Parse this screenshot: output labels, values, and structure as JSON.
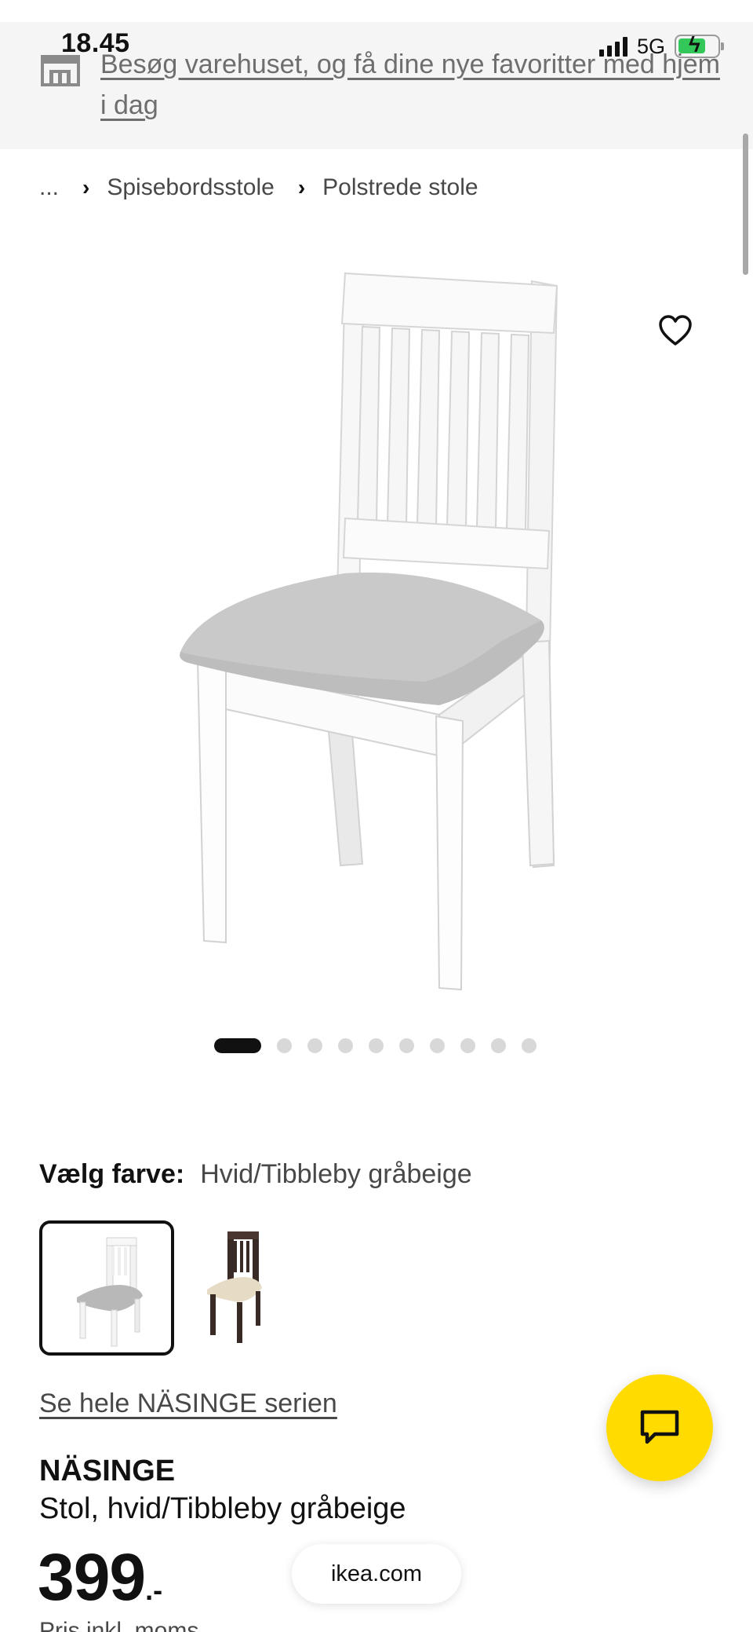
{
  "status_bar": {
    "time": "18.45",
    "network": "5G"
  },
  "banner": {
    "icon": "store-icon",
    "text": "Besøg varehuset, og få dine nye favoritter med hjem i dag"
  },
  "breadcrumb": {
    "items": [
      "...",
      "Spisebordsstole",
      "Polstrede stole"
    ]
  },
  "gallery": {
    "image_count": 10,
    "active_index": 0,
    "favorite_icon": "heart-icon"
  },
  "color_picker": {
    "label": "Vælg farve:",
    "selected_value": "Hvid/Tibbleby gråbeige",
    "options": [
      {
        "id": "white-grey",
        "selected": true
      },
      {
        "id": "brown-beige",
        "selected": false
      }
    ]
  },
  "series_link": "Se hele NÄSINGE serien",
  "product": {
    "name": "NÄSINGE",
    "description": "Stol, hvid/Tibbleby gråbeige",
    "price": "399",
    "price_suffix": ".-",
    "price_note": "Pris inkl. moms"
  },
  "browser": {
    "url": "ikea.com"
  },
  "chat": {
    "icon": "chat-icon"
  },
  "colors": {
    "chat_button": "#ffdb00",
    "banner_bg": "#f5f5f5",
    "text_primary": "#111111",
    "text_secondary": "#484848"
  }
}
